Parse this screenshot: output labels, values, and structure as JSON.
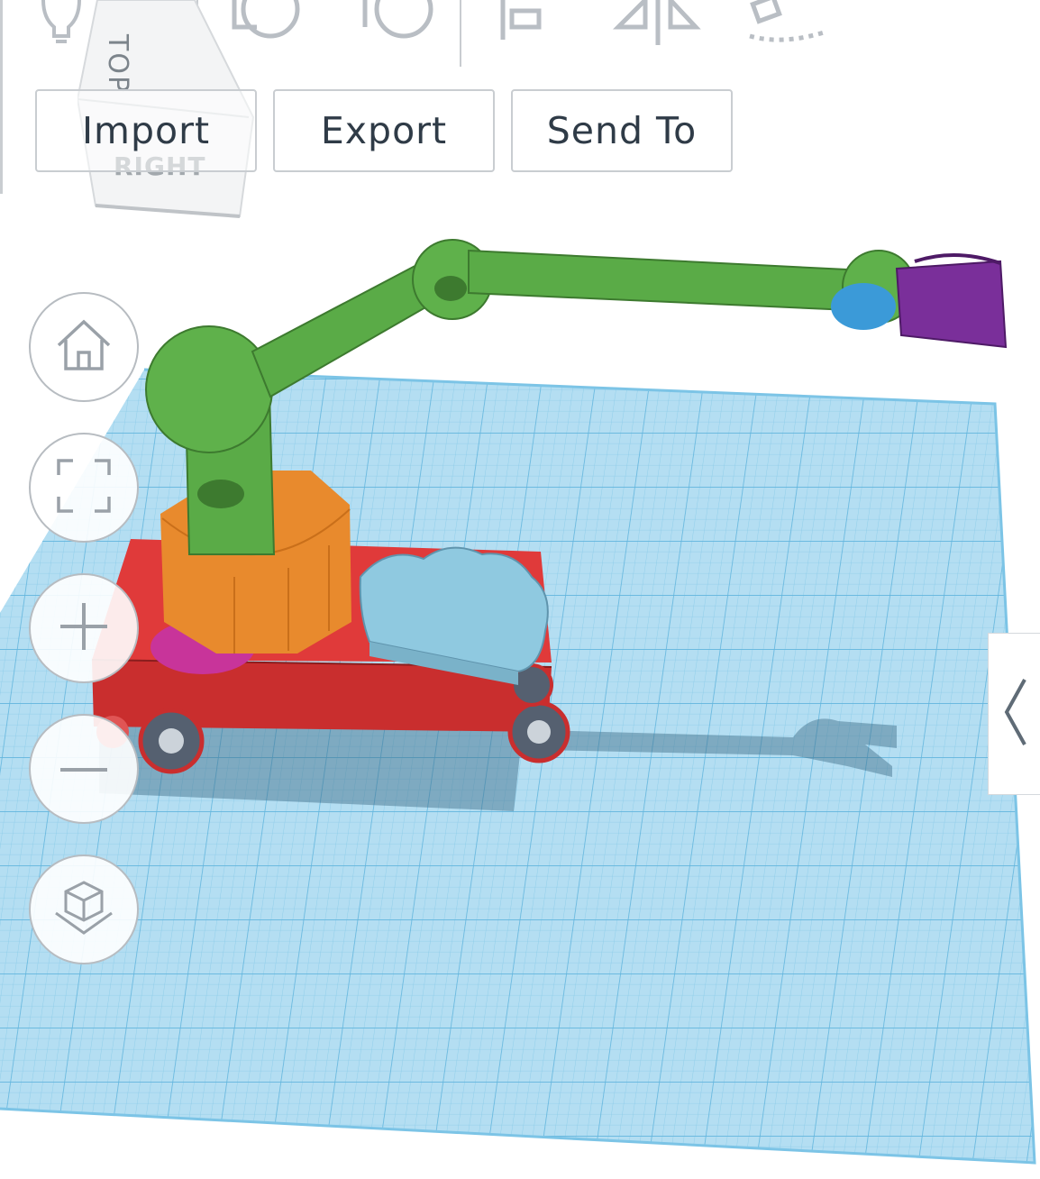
{
  "toolbar": {
    "icons": [
      "lightbulb-icon",
      "notes-icon",
      "rotate-shape-icon",
      "circle-shape-icon",
      "align-icon",
      "mirror-icon",
      "group-icon"
    ],
    "import_label": "Import",
    "export_label": "Export",
    "sendto_label": "Send To"
  },
  "viewcube": {
    "top_label": "TOP",
    "right_label": "RIGHT"
  },
  "view_controls": [
    "home-view-icon",
    "fit-all-icon",
    "zoom-in-icon",
    "zoom-out-icon",
    "ortho-view-icon"
  ],
  "side_panel": {
    "toggle_icon": "chevron-left-icon"
  },
  "colors": {
    "workplane": "#a9d9f0",
    "grid": "#6fbde3",
    "arm": "#5aab47",
    "base": "#e88a2d",
    "cart": "#d23535",
    "cloud": "#8fc9e0",
    "gripper": "#7a2f9a",
    "ball": "#3b9ad8",
    "egg": "#c8349a"
  }
}
